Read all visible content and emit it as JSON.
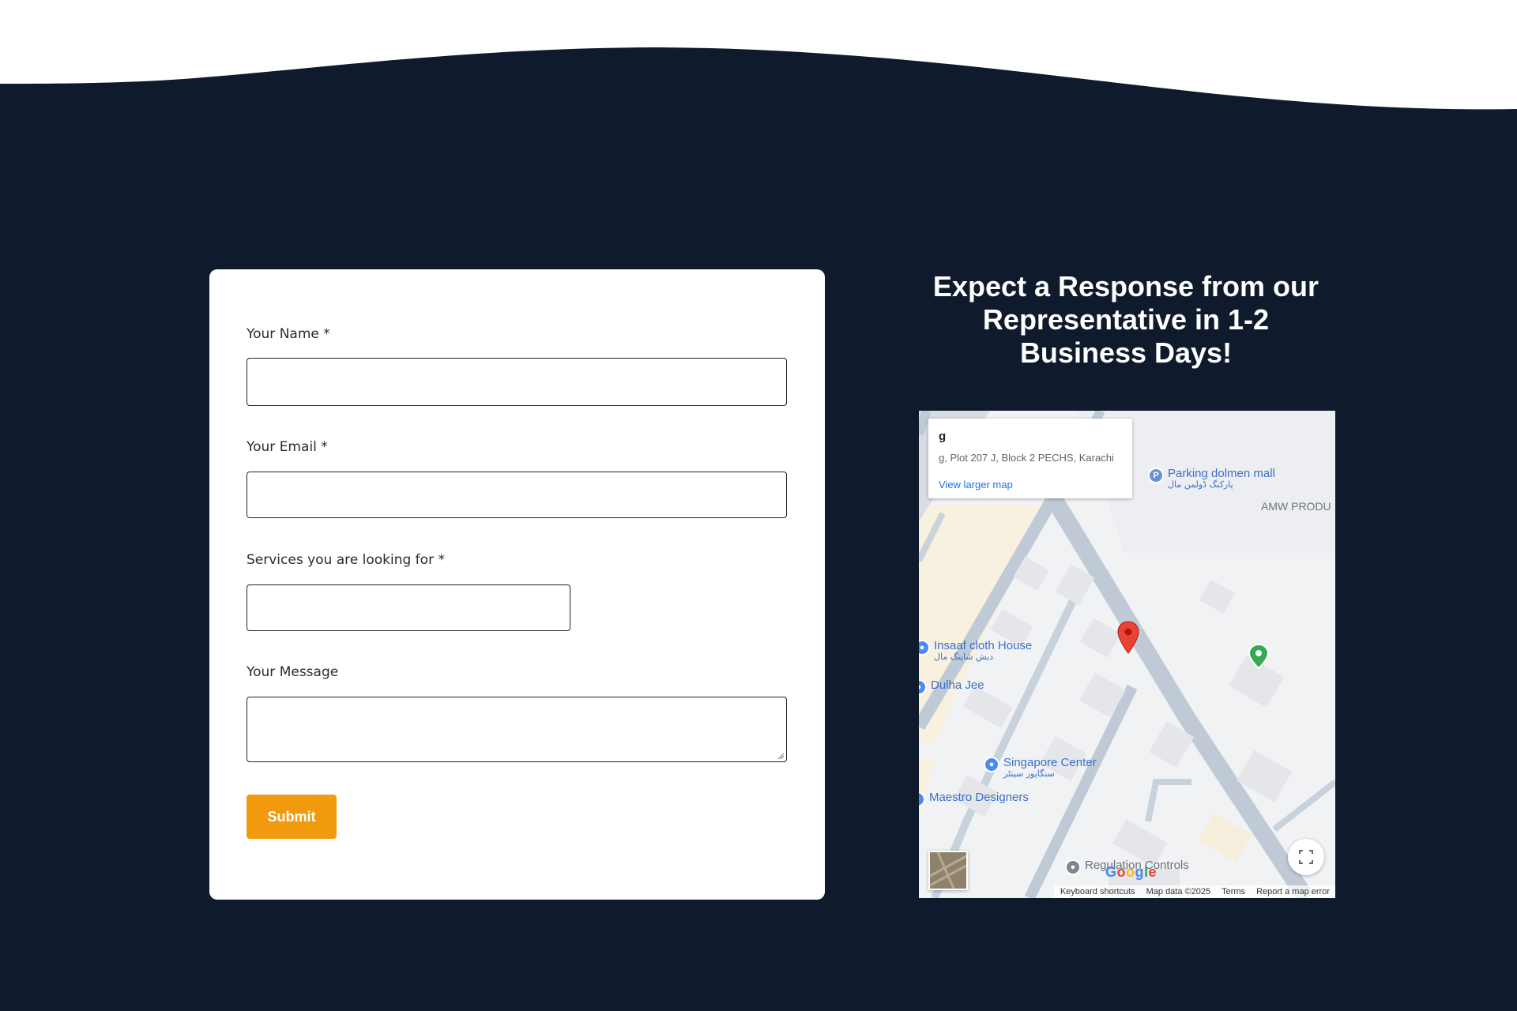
{
  "form": {
    "name_label": "Your Name *",
    "email_label": "Your Email *",
    "services_label": "Services you are looking for *",
    "message_label": "Your Message",
    "name_value": "",
    "email_value": "",
    "services_value": "",
    "message_value": "",
    "submit_label": "Submit"
  },
  "headline": {
    "line1": "Expect a Response from our",
    "line2": "Representative in 1-2",
    "line3": "Business Days!"
  },
  "map": {
    "info_title": "g",
    "info_address": "g, Plot 207 J, Block 2 PECHS, Karachi",
    "view_larger": "View larger map",
    "pois": {
      "parking": "Parking dolmen mall",
      "parking_sub": "پارکنگ ڈولمن مال",
      "amw": "AMW PRODU",
      "insaaf": "Insaaf cloth House",
      "insaaf_sub": "دیش شاپنگ مال",
      "dulha": "Dulha Jee",
      "singapore": "Singapore Center",
      "singapore_sub": "سنگاپور سینٹر",
      "maestro": "Maestro Designers",
      "regulation": "Regulation Controls"
    },
    "google": "Google",
    "attribution": {
      "shortcuts": "Keyboard shortcuts",
      "data": "Map data ©2025",
      "terms": "Terms",
      "report": "Report a map error"
    }
  },
  "colors": {
    "background": "#0f1a2c",
    "accent": "#f29a0e",
    "card": "#ffffff"
  }
}
